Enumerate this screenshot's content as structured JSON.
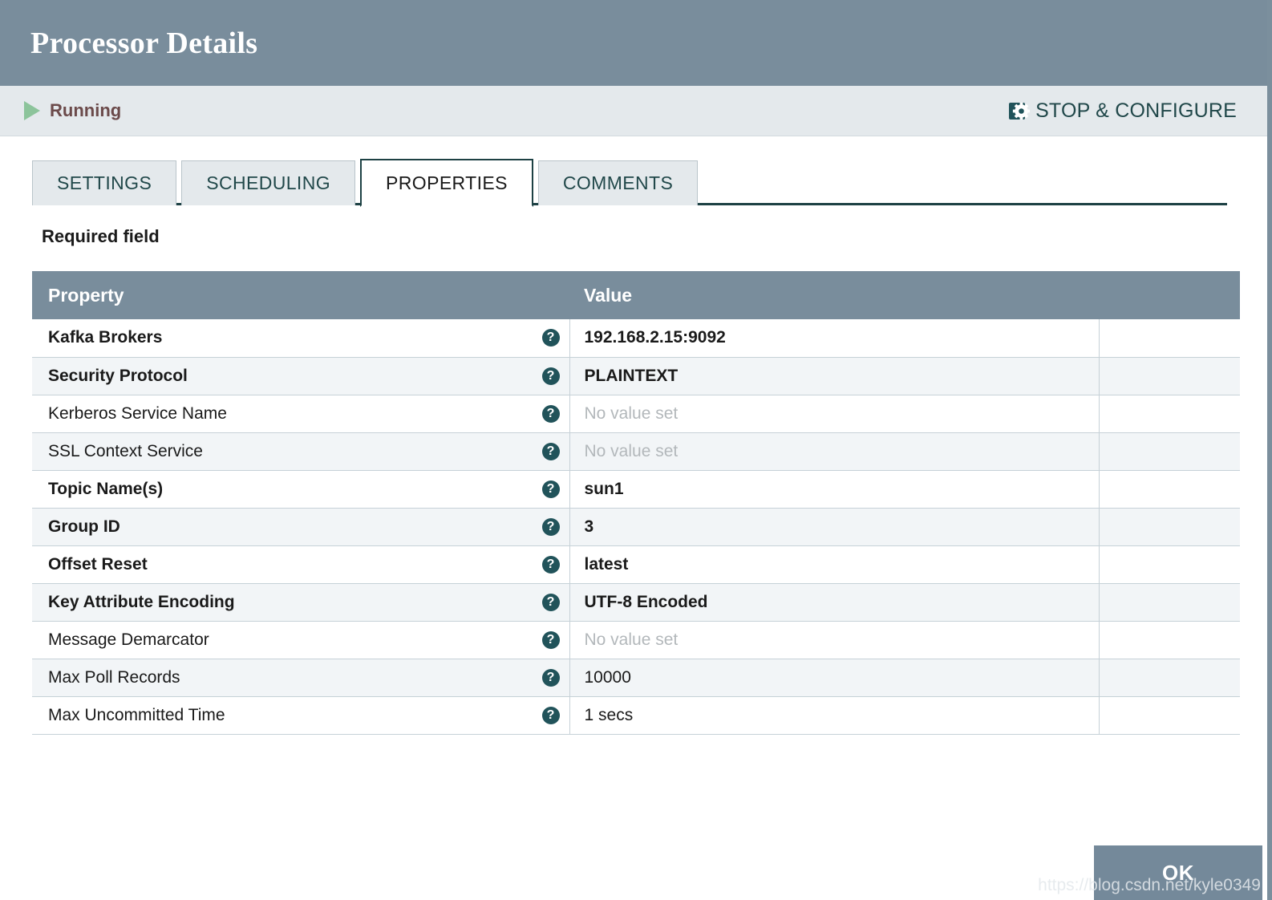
{
  "window": {
    "title": "Processor Details"
  },
  "status": {
    "state_label": "Running",
    "play_icon": "play-icon",
    "action_label": "STOP & CONFIGURE",
    "action_icon": "stop-and-configure-icon",
    "running_color": "#6b4a4a",
    "play_color": "#8cc49b",
    "action_color": "#21484a"
  },
  "tabs": [
    {
      "label": "SETTINGS",
      "active": false
    },
    {
      "label": "SCHEDULING",
      "active": false
    },
    {
      "label": "PROPERTIES",
      "active": true
    },
    {
      "label": "COMMENTS",
      "active": false
    }
  ],
  "content": {
    "required_field_note": "Required field"
  },
  "table": {
    "columns": [
      "Property",
      "Value"
    ],
    "help_icon": "help-circle-icon",
    "empty_value_text": "No value set",
    "rows": [
      {
        "property": "Kafka Brokers",
        "value": "192.168.2.15:9092",
        "required": true,
        "empty": false
      },
      {
        "property": "Security Protocol",
        "value": "PLAINTEXT",
        "required": true,
        "empty": false
      },
      {
        "property": "Kerberos Service Name",
        "value": "No value set",
        "required": false,
        "empty": true
      },
      {
        "property": "SSL Context Service",
        "value": "No value set",
        "required": false,
        "empty": true
      },
      {
        "property": "Topic Name(s)",
        "value": "sun1",
        "required": true,
        "empty": false
      },
      {
        "property": "Group ID",
        "value": "3",
        "required": true,
        "empty": false
      },
      {
        "property": "Offset Reset",
        "value": "latest",
        "required": true,
        "empty": false
      },
      {
        "property": "Key Attribute Encoding",
        "value": "UTF-8 Encoded",
        "required": true,
        "empty": false
      },
      {
        "property": "Message Demarcator",
        "value": "No value set",
        "required": false,
        "empty": true
      },
      {
        "property": "Max Poll Records",
        "value": "10000",
        "required": false,
        "empty": false
      },
      {
        "property": "Max Uncommitted Time",
        "value": "1 secs",
        "required": false,
        "empty": false
      }
    ]
  },
  "footer": {
    "ok_label": "OK",
    "watermark": "https://blog.csdn.net/kyle0349"
  },
  "colors": {
    "header_bg": "#798d9c",
    "status_bg": "#e4e9ec",
    "tab_active_border": "#1d4144",
    "help_icon_bg": "#21535a",
    "ok_button_bg": "#74899a",
    "row_alt_bg": "#f2f5f7"
  }
}
